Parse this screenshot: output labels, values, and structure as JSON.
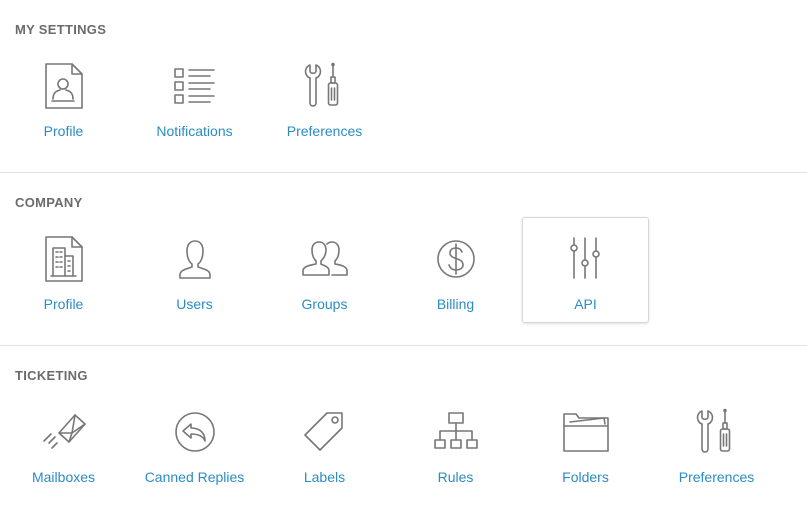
{
  "sections": {
    "my_settings": {
      "title": "MY SETTINGS",
      "items": [
        {
          "label": "Profile",
          "icon": "profile-document-icon"
        },
        {
          "label": "Notifications",
          "icon": "list-icon"
        },
        {
          "label": "Preferences",
          "icon": "tools-icon"
        }
      ]
    },
    "company": {
      "title": "COMPANY",
      "items": [
        {
          "label": "Profile",
          "icon": "building-document-icon"
        },
        {
          "label": "Users",
          "icon": "user-icon"
        },
        {
          "label": "Groups",
          "icon": "group-icon"
        },
        {
          "label": "Billing",
          "icon": "dollar-icon"
        },
        {
          "label": "API",
          "icon": "sliders-icon",
          "active": true
        }
      ]
    },
    "ticketing": {
      "title": "TICKETING",
      "items": [
        {
          "label": "Mailboxes",
          "icon": "mail-send-icon"
        },
        {
          "label": "Canned Replies",
          "icon": "reply-icon"
        },
        {
          "label": "Labels",
          "icon": "tag-icon"
        },
        {
          "label": "Rules",
          "icon": "hierarchy-icon"
        },
        {
          "label": "Folders",
          "icon": "folder-icon"
        },
        {
          "label": "Preferences",
          "icon": "tools-icon"
        }
      ]
    }
  },
  "colors": {
    "link": "#2b8cc4",
    "heading": "#6b6b6b",
    "icon": "#777777",
    "divider": "#e3e3e3"
  }
}
